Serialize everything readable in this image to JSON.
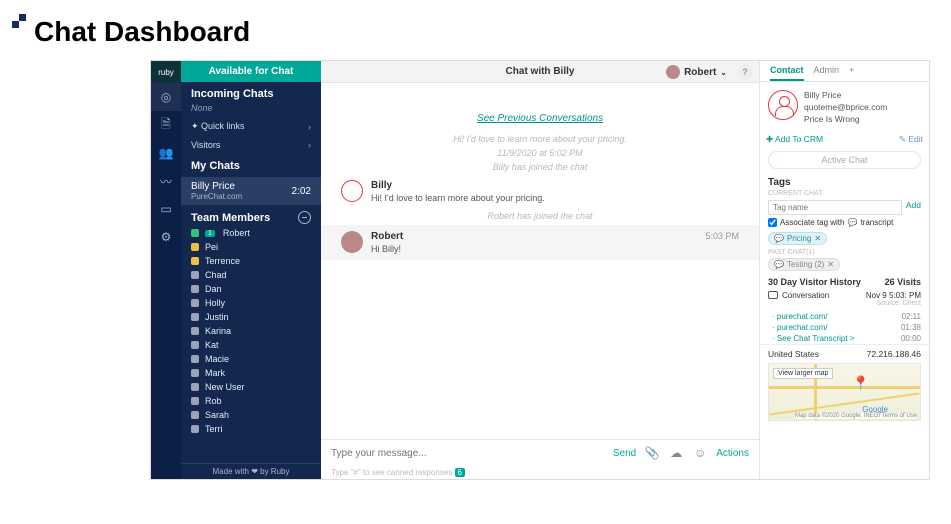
{
  "page_title": "Chat Dashboard",
  "brand": "ruby",
  "availability": "Available for Chat",
  "incoming": {
    "header": "Incoming Chats",
    "none": "None"
  },
  "quicklinks_label": "Quick links",
  "visitors_label": "Visitors",
  "mychats": {
    "header": "My Chats",
    "item": {
      "name": "Billy Price",
      "site": "PureChat.com",
      "time": "2:02"
    }
  },
  "team": {
    "header": "Team Members",
    "members": [
      {
        "name": "Robert",
        "status": "g",
        "badge": "1"
      },
      {
        "name": "Pei",
        "status": "y"
      },
      {
        "name": "Terrence",
        "status": "y"
      },
      {
        "name": "Chad",
        "status": "o"
      },
      {
        "name": "Dan",
        "status": "o"
      },
      {
        "name": "Holly",
        "status": "o"
      },
      {
        "name": "Justin",
        "status": "o"
      },
      {
        "name": "Karina",
        "status": "o"
      },
      {
        "name": "Kat",
        "status": "o"
      },
      {
        "name": "Macie",
        "status": "o"
      },
      {
        "name": "Mark",
        "status": "o"
      },
      {
        "name": "New User",
        "status": "o"
      },
      {
        "name": "Rob",
        "status": "o"
      },
      {
        "name": "Sarah",
        "status": "o"
      },
      {
        "name": "Terri",
        "status": "o"
      }
    ]
  },
  "madewith": "Made with ❤ by Ruby",
  "header": {
    "title": "Chat with Billy",
    "user": "Robert"
  },
  "chat": {
    "prev": "See Previous Conversations",
    "sys1": "Hi! I'd love to learn more about your pricing.",
    "sys2": "11/9/2020 at 5:02 PM",
    "sys3": "Billy has joined the chat",
    "msg1": {
      "name": "Billy",
      "text": "Hi! I'd love to learn more about your pricing."
    },
    "sys4": "Robert has joined the chat",
    "msg2": {
      "name": "Robert",
      "text": "Hi Billy!",
      "time": "5:03 PM"
    },
    "placeholder": "Type your message...",
    "send": "Send",
    "actions": "Actions",
    "hint_pre": "Type \"#\" to see canned responses",
    "hint_badge": "6"
  },
  "rp": {
    "tab_contact": "Contact",
    "tab_admin": "Admin",
    "contact": {
      "name": "Billy Price",
      "email": "quoteme@bprice.com",
      "company": "Price Is Wrong"
    },
    "addcrm": "Add To CRM",
    "edit_label": "Edit",
    "activechat": "Active Chat",
    "tags": {
      "h": "Tags",
      "sub1": "CURRENT CHAT",
      "placeholder": "Tag name",
      "add": "Add",
      "assoc": "Associate tag with",
      "assoc2": "transcript",
      "pill1": "Pricing",
      "sub2": "PAST CHAT(1)",
      "pill2": "Testing (2)"
    },
    "history": {
      "h": "30 Day Visitor History",
      "visits": "26 Visits",
      "conv": "Conversation",
      "date": "Nov 9 5:03: PM",
      "src": "Source: Direct",
      "rows": [
        {
          "url": "purechat.com/",
          "t": "02:11"
        },
        {
          "url": "purechat.com/",
          "t": "01:38"
        },
        {
          "url": "See Chat Transcript >",
          "t": "00:00"
        }
      ]
    },
    "geo": {
      "country": "United States",
      "ip": "72.216.188.46"
    },
    "map": {
      "viewlg": "View larger map",
      "google": "Google",
      "attr": "Map data ©2020 Google, INEGI   Terms of Use"
    }
  }
}
